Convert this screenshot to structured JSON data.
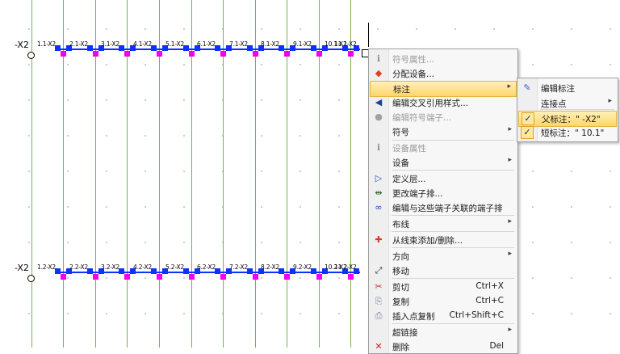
{
  "schematic": {
    "row1_label": "-X2",
    "row2_label": "-X2",
    "row1_terms": [
      "1.1-X2",
      "2.1-X2",
      "3.1-X2",
      "4.1-X2",
      "5.1-X2",
      "6.1-X2",
      "7.1-X2",
      "8.1-X2",
      "9.1-X2",
      "10.1-X2",
      "11.1-X2"
    ],
    "row2_terms": [
      "1.2-X2",
      "2.2-X2",
      "3.2-X2",
      "4.2-X2",
      "5.2-X2",
      "6.2-X2",
      "7.2-X2",
      "8.2-X2",
      "9.2-X2",
      "10.2-X2",
      "11.2-X2"
    ]
  },
  "context_menu": {
    "items": [
      {
        "label": "符号属性...",
        "icon": "info-icon",
        "disabled": true
      },
      {
        "label": "分配设备...",
        "icon": "assign-device-icon"
      },
      {
        "label": "标注",
        "submenu": true,
        "highlighted": true
      },
      {
        "label": "编辑交叉引用样式...",
        "icon": "cross-ref-style-icon"
      },
      {
        "label": "编辑符号端子...",
        "icon": "symbol-terminal-icon",
        "disabled": true
      },
      {
        "label": "符号",
        "submenu": true
      },
      {
        "label": "设备属性",
        "icon": "info-icon",
        "disabled": true
      },
      {
        "label": "设备",
        "submenu": true
      },
      {
        "label": "定义层...",
        "icon": "layer-icon"
      },
      {
        "label": "更改端子排...",
        "icon": "change-terminal-strip-icon"
      },
      {
        "label": "编辑与这些端子关联的端子排",
        "icon": "terminal-strip-icon"
      },
      {
        "label": "布线",
        "submenu": true
      },
      {
        "label": "从线束添加/删除...",
        "icon": "harness-icon"
      },
      {
        "label": "方向",
        "submenu": true
      },
      {
        "label": "移动",
        "icon": "move-icon"
      },
      {
        "label": "剪切",
        "icon": "cut-icon",
        "shortcut": "Ctrl+X"
      },
      {
        "label": "复制",
        "icon": "copy-icon",
        "shortcut": "Ctrl+C"
      },
      {
        "label": "插入点复制",
        "icon": "insert-point-copy-icon",
        "shortcut": "Ctrl+Shift+C"
      },
      {
        "label": "超链接",
        "submenu": true
      },
      {
        "label": "删除",
        "icon": "delete-icon",
        "shortcut": "Del"
      }
    ]
  },
  "submenu": {
    "items": [
      {
        "label": "编辑标注",
        "icon": "edit-annotation-icon"
      },
      {
        "label": "连接点",
        "submenu": true
      },
      {
        "label": "父标注：\" -X2\"",
        "checked": true,
        "highlighted": true
      },
      {
        "label": "短标注：\" 10.1\"",
        "checked": true
      }
    ]
  },
  "colors": {
    "wire": "#7bb04a",
    "terminal_top": "#1030ff",
    "terminal_bottom": "#f000f0",
    "menu_highlight": "#ffd56a"
  }
}
